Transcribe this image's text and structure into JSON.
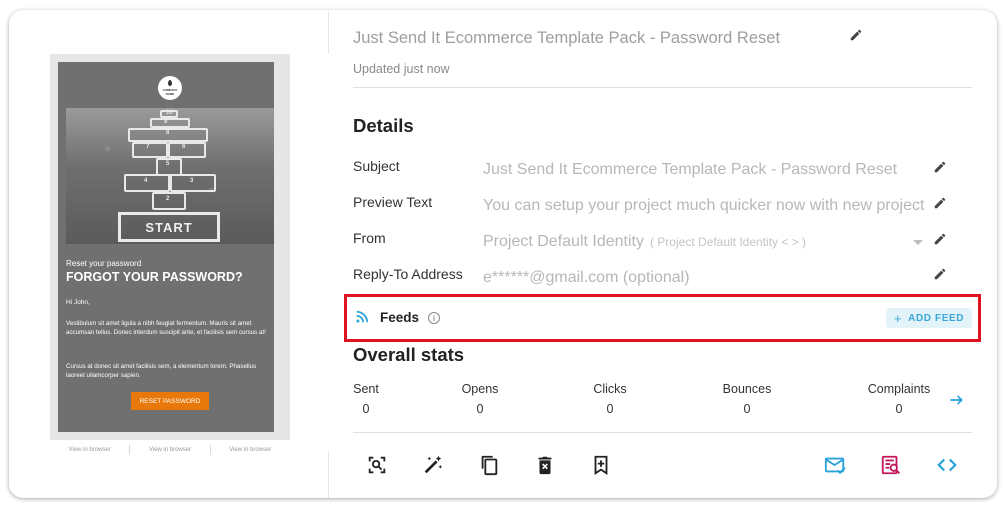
{
  "template": {
    "title": "Just Send It Ecommerce Template Pack - Password Reset",
    "updated": "Updated just now"
  },
  "preview": {
    "logo_text": "COMPANY NAME",
    "hero_start": "START",
    "hero_numbers": [
      "10",
      "9",
      "8",
      "7",
      "6",
      "5",
      "4",
      "3",
      "2",
      "1"
    ],
    "reset_small": "Reset your password",
    "heading": "FORGOT YOUR PASSWORD?",
    "greeting": "Hi John,",
    "paragraph1": "Vestibulum sit amet ligula a nibh feugiat fermentum. Mauris sit amet accumsan tellus. Donec interdum suscipit ante, et facilisis sem cursus at!",
    "paragraph2": "Cursus at donec sit amet facilisis sem, a elementum lorem. Phasellus laoreet ullamcorper sapien.",
    "button": "RESET PASSWORD",
    "view_links": [
      "View in browser",
      "View in browser",
      "View in browser"
    ]
  },
  "details": {
    "heading": "Details",
    "fields": [
      {
        "label": "Subject",
        "value": "Just Send It Ecommerce Template Pack - Password Reset"
      },
      {
        "label": "Preview Text",
        "value": "You can setup your project much quicker now with new project"
      },
      {
        "label": "From",
        "value": "Project Default Identity",
        "sub": "( Project Default Identity < > )"
      },
      {
        "label": "Reply-To Address",
        "value": "e******@gmail.com (optional)"
      }
    ]
  },
  "feeds": {
    "label": "Feeds",
    "add_button": "ADD FEED",
    "add_icon": "+"
  },
  "stats": {
    "heading": "Overall stats",
    "items": [
      {
        "label": "Sent",
        "value": "0"
      },
      {
        "label": "Opens",
        "value": "0"
      },
      {
        "label": "Clicks",
        "value": "0"
      },
      {
        "label": "Bounces",
        "value": "0"
      },
      {
        "label": "Complaints",
        "value": "0"
      }
    ]
  },
  "toolbar": {
    "icons": [
      "inspect-icon",
      "magic-wand-icon",
      "copy-icon",
      "delete-icon",
      "bookmark-add-icon",
      "send-test-email-icon",
      "spam-check-icon",
      "code-icon"
    ]
  },
  "colors": {
    "accent": "#29a3d9",
    "danger": "#c2185b",
    "highlight_border": "#e0121f",
    "button_orange": "#e8780a"
  }
}
